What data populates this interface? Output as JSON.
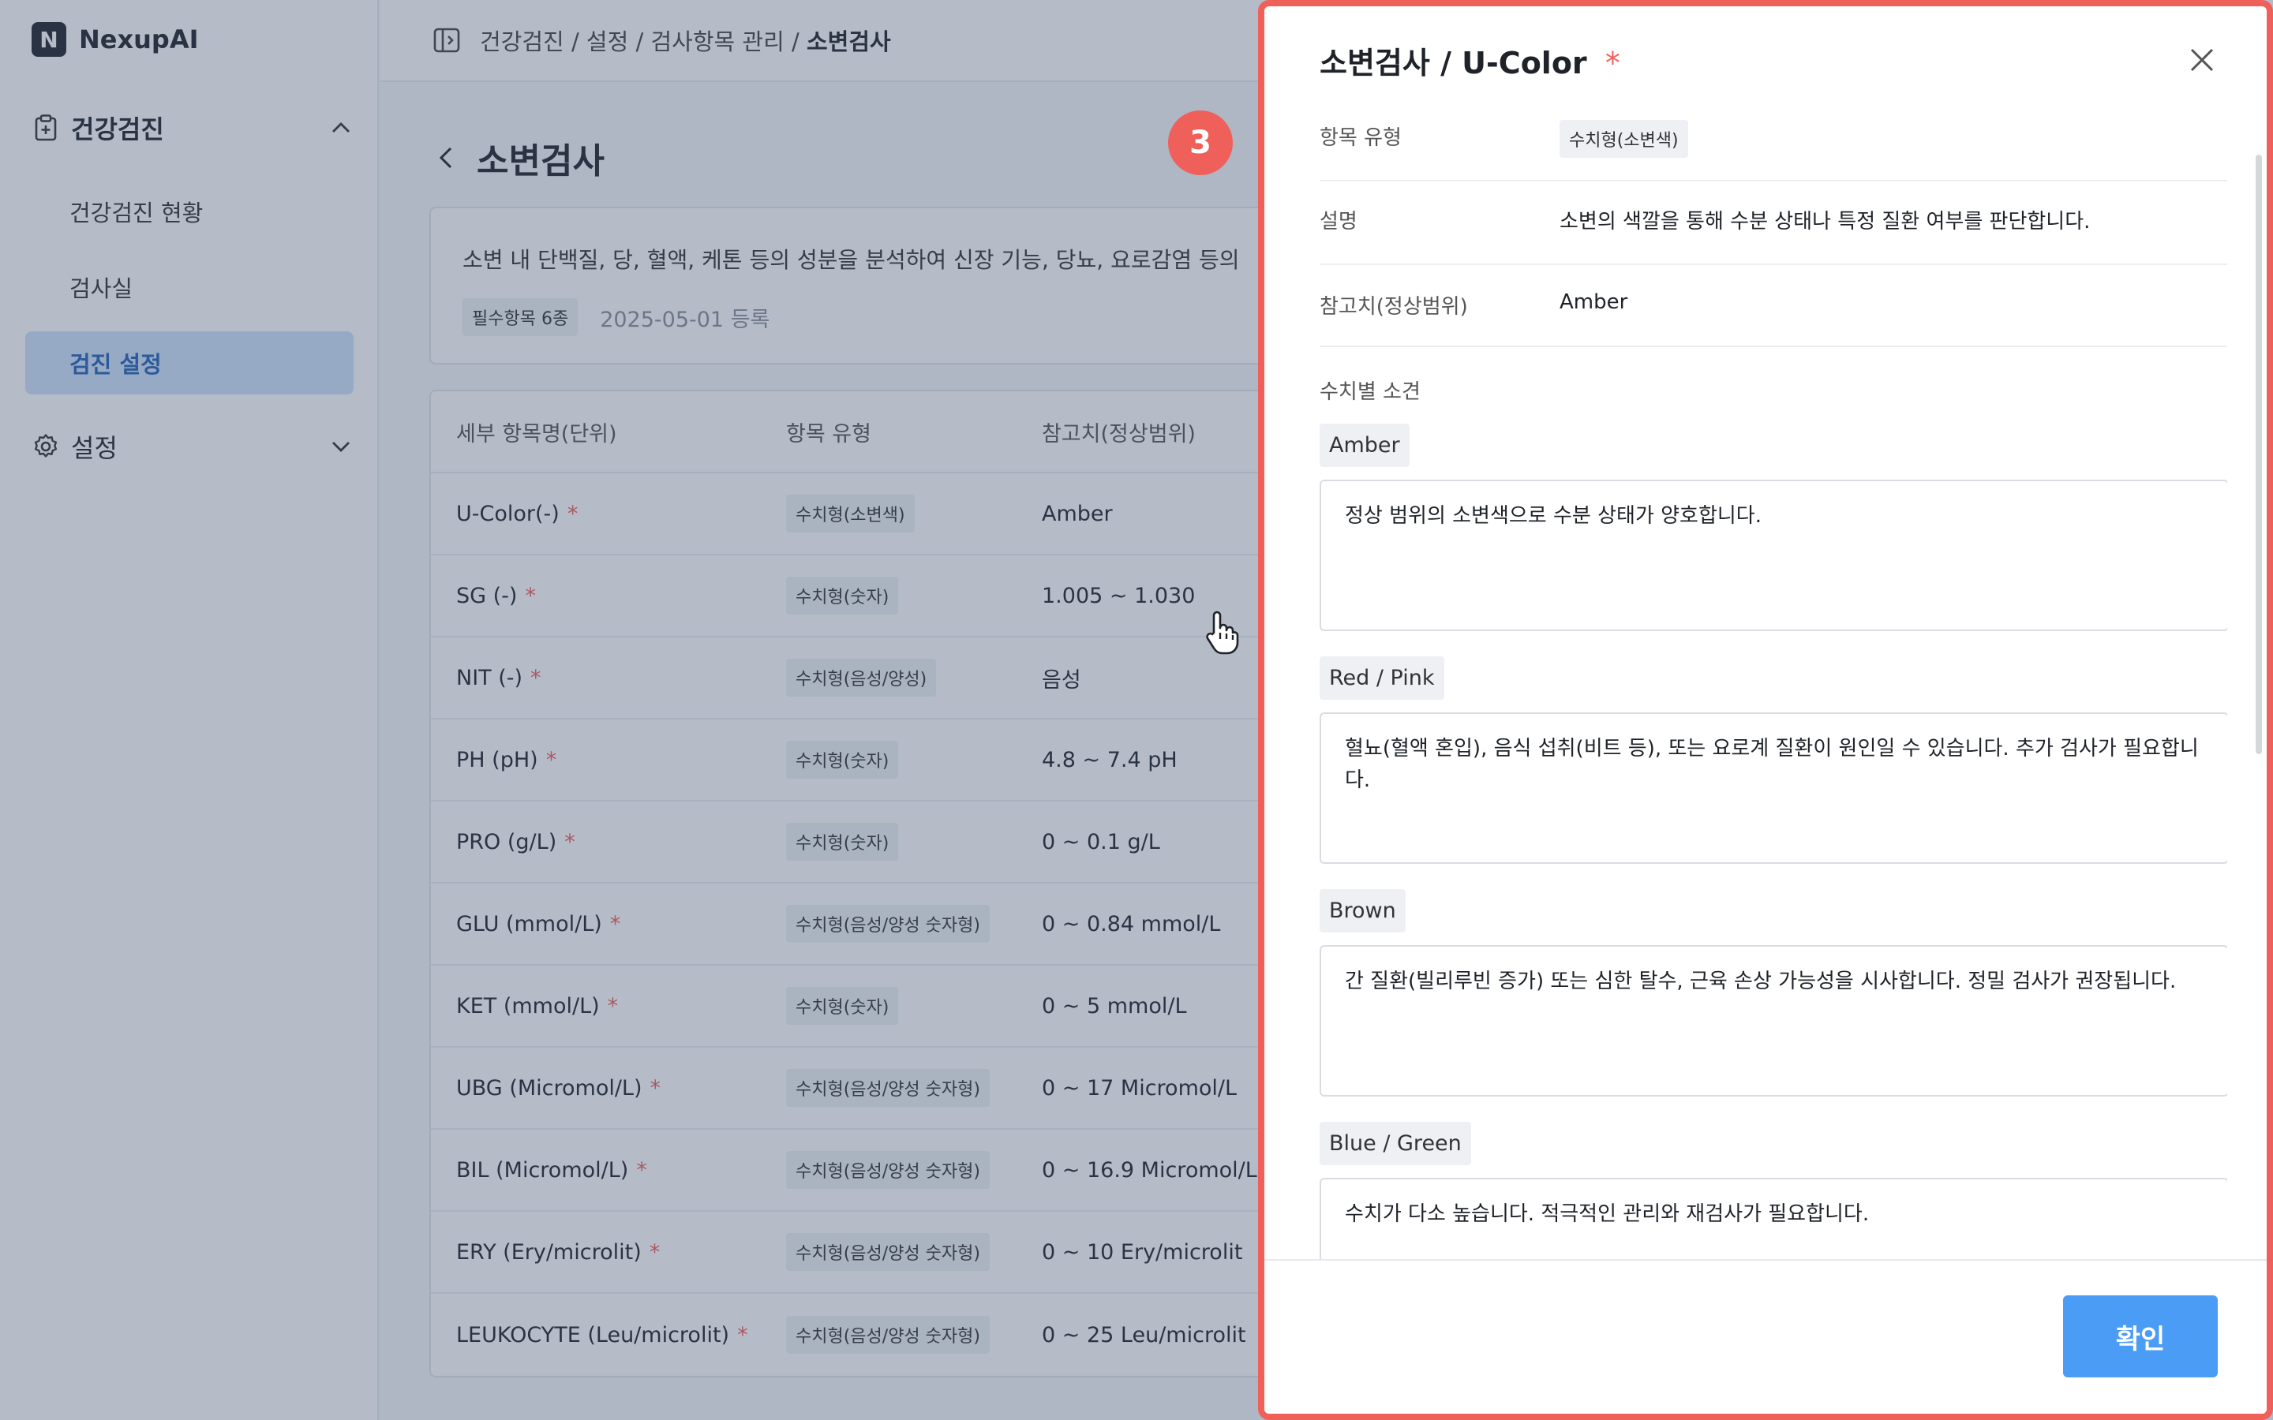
{
  "app": {
    "logo_letter": "N",
    "name": "NexupAI"
  },
  "sidebar": {
    "groups": [
      {
        "label": "건강검진",
        "icon": "clipboard-plus-icon",
        "expanded": true
      },
      {
        "label": "설정",
        "icon": "gear-icon",
        "expanded": false
      }
    ],
    "items": [
      {
        "label": "건강검진 현황",
        "active": false
      },
      {
        "label": "검사실",
        "active": false
      },
      {
        "label": "검진 설정",
        "active": true
      }
    ]
  },
  "breadcrumb": {
    "path": "건강검진 / 설정 / 검사항목 관리 / ",
    "current": "소변검사"
  },
  "page": {
    "title": "소변검사",
    "description": "소변 내 단백질, 당, 혈액, 케톤 등의 성분을 분석하여 신장 기능, 당뇨, 요로감염 등의",
    "tag": "필수항목 6종",
    "registered": "2025-05-01 등록"
  },
  "table": {
    "headers": [
      "세부 항목명(단위)",
      "항목 유형",
      "참고치(정상범위)"
    ],
    "rows": [
      {
        "name": "U-Color(-)",
        "type": "수치형(소변색)",
        "ref": "Amber"
      },
      {
        "name": "SG (-)",
        "type": "수치형(숫자)",
        "ref": "1.005 ~ 1.030"
      },
      {
        "name": "NIT (-)",
        "type": "수치형(음성/양성)",
        "ref": "음성"
      },
      {
        "name": "PH (pH)",
        "type": "수치형(숫자)",
        "ref": "4.8 ~ 7.4 pH"
      },
      {
        "name": "PRO (g/L)",
        "type": "수치형(숫자)",
        "ref": "0 ~ 0.1 g/L"
      },
      {
        "name": "GLU (mmol/L)",
        "type": "수치형(음성/양성 숫자형)",
        "ref": "0 ~ 0.84 mmol/L"
      },
      {
        "name": "KET (mmol/L)",
        "type": "수치형(숫자)",
        "ref": "0 ~ 5 mmol/L"
      },
      {
        "name": "UBG (Micromol/L)",
        "type": "수치형(음성/양성 숫자형)",
        "ref": "0 ~ 17 Micromol/L"
      },
      {
        "name": "BIL (Micromol/L)",
        "type": "수치형(음성/양성 숫자형)",
        "ref": "0 ~ 16.9 Micromol/L"
      },
      {
        "name": "ERY (Ery/microlit)",
        "type": "수치형(음성/양성 숫자형)",
        "ref": "0 ~ 10 Ery/microlit"
      },
      {
        "name": "LEUKOCYTE (Leu/microlit)",
        "type": "수치형(음성/양성 숫자형)",
        "ref": "0 ~ 25 Leu/microlit"
      }
    ],
    "required_mark": "*"
  },
  "step_badge": "3",
  "drawer": {
    "title": "소변검사 / U-Color",
    "required_mark": "*",
    "fields": {
      "type_label": "항목 유형",
      "type_value": "수치형(소변색)",
      "desc_label": "설명",
      "desc_value": "소변의 색깔을 통해 수분 상태나 특정 질환 여부를 판단합니다.",
      "ref_label": "참고치(정상범위)",
      "ref_value": "Amber"
    },
    "findings_label": "수치별 소견",
    "findings": [
      {
        "tag": "Amber",
        "text": "정상 범위의 소변색으로 수분 상태가 양호합니다."
      },
      {
        "tag": "Red / Pink",
        "text": "혈뇨(혈액 혼입), 음식 섭취(비트 등), 또는 요로계 질환이 원인일 수 있습니다. 추가 검사가 필요합니다."
      },
      {
        "tag": "Brown",
        "text": "간 질환(빌리루빈 증가) 또는 심한 탈수, 근육 손상 가능성을 시사합니다. 정밀 검사가 권장됩니다."
      },
      {
        "tag": "Blue / Green",
        "text": "수치가 다소 높습니다. 적극적인 관리와 재검사가 필요합니다."
      }
    ],
    "confirm_label": "확인"
  },
  "colors": {
    "accent": "#4b9cf5",
    "highlight": "#f0605a",
    "active_nav_bg": "#cfe3fb"
  }
}
